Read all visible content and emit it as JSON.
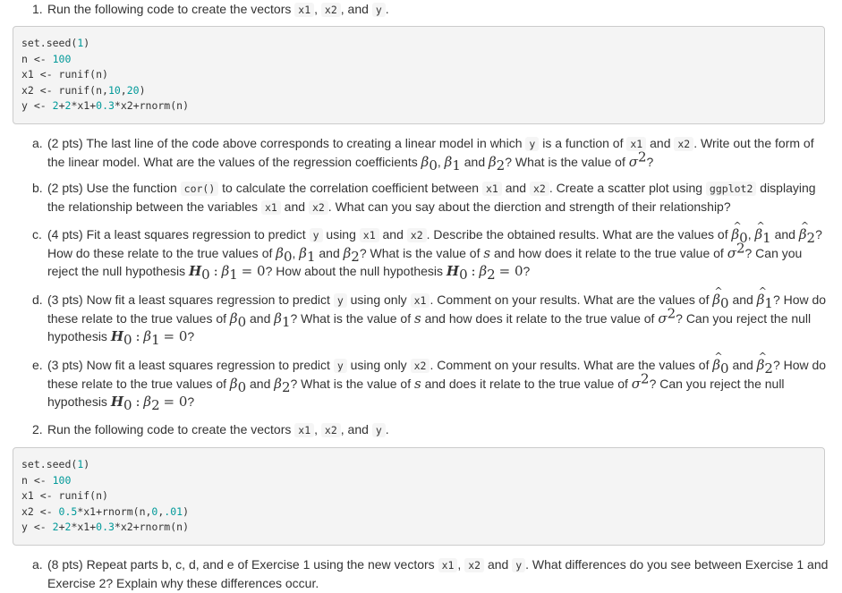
{
  "exercise1": {
    "marker": "1.",
    "intro_text": "Run the following code to create the vectors",
    "vars": [
      "x1",
      "x2",
      "y"
    ],
    "code": [
      {
        "parts": [
          {
            "t": "set.seed("
          },
          {
            "t": "1",
            "n": true
          },
          {
            "t": ")"
          }
        ]
      },
      {
        "parts": [
          {
            "t": "n <- "
          },
          {
            "t": "100",
            "n": true
          }
        ]
      },
      {
        "parts": [
          {
            "t": "x1 <- runif(n)"
          }
        ]
      },
      {
        "parts": [
          {
            "t": "x2 <- runif(n,"
          },
          {
            "t": "10",
            "n": true
          },
          {
            "t": ","
          },
          {
            "t": "20",
            "n": true
          },
          {
            "t": ")"
          }
        ]
      },
      {
        "parts": [
          {
            "t": "y <- "
          },
          {
            "t": "2",
            "n": true
          },
          {
            "t": "+"
          },
          {
            "t": "2",
            "n": true
          },
          {
            "t": "*x1+"
          },
          {
            "t": "0.3",
            "n": true
          },
          {
            "t": "*x2+rnorm(n)"
          }
        ]
      }
    ],
    "parts": [
      {
        "marker": "a.",
        "text": "(2 pts) The last line of the code above corresponds to creating a linear model in which y is a function of x1 and x2. Write out the form of the linear model. What are the values of the regression coefficients β0, β1 and β2? What is the value of σ²?"
      },
      {
        "marker": "b.",
        "text": "(2 pts) Use the function cor() to calculate the correlation coefficient between x1 and x2. Create a scatter plot using ggplot2 displaying the relationship between the variables x1 and x2. What can you say about the dierction and strength of their relationship?"
      },
      {
        "marker": "c.",
        "text": "(4 pts) Fit a least squares regression to predict y using x1 and x2. Describe the obtained results. What are the values of β̂0, β̂1 and β̂2? How do these relate to the true values of β0, β1 and β2? What is the value of s and how does it relate to the true value of σ²? Can you reject the null hypothesis H0 : β1 = 0? How about the null hypothesis H0 : β2 = 0?"
      },
      {
        "marker": "d.",
        "text": "(3 pts) Now fit a least squares regression to predict y using only x1. Comment on your results. What are the values of β̂0 and β̂1? How do these relate to the true values of β0 and β1? What is the value of s and how does it relate to the true value of σ²? Can you reject the null hypothesis H0 : β1 = 0?"
      },
      {
        "marker": "e.",
        "text": "(3 pts) Now fit a least squares regression to predict y using only x2. Comment on your results. What are the values of β̂0 and β̂2? How do these relate to the true values of β0 and β2? What is the value of s and does it relate to the true value of σ²? Can you reject the null hypothesis H0 : β2 = 0?"
      }
    ]
  },
  "exercise2": {
    "marker": "2.",
    "intro_text": "Run the following code to create the vectors",
    "vars": [
      "x1",
      "x2",
      "y"
    ],
    "code": [
      {
        "parts": [
          {
            "t": "set.seed("
          },
          {
            "t": "1",
            "n": true
          },
          {
            "t": ")"
          }
        ]
      },
      {
        "parts": [
          {
            "t": "n <- "
          },
          {
            "t": "100",
            "n": true
          }
        ]
      },
      {
        "parts": [
          {
            "t": "x1 <- runif(n)"
          }
        ]
      },
      {
        "parts": [
          {
            "t": "x2 <- "
          },
          {
            "t": "0.5",
            "n": true
          },
          {
            "t": "*x1+rnorm(n,"
          },
          {
            "t": "0",
            "n": true
          },
          {
            "t": ","
          },
          {
            "t": ".01",
            "n": true
          },
          {
            "t": ")"
          }
        ]
      },
      {
        "parts": [
          {
            "t": "y <- "
          },
          {
            "t": "2",
            "n": true
          },
          {
            "t": "+"
          },
          {
            "t": "2",
            "n": true
          },
          {
            "t": "*x1+"
          },
          {
            "t": "0.3",
            "n": true
          },
          {
            "t": "*x2+rnorm(n)"
          }
        ]
      }
    ],
    "parts": [
      {
        "marker": "a.",
        "text": "(8 pts) Repeat parts b, c, d, and e of Exercise 1 using the new vectors x1, x2 and y. What differences do you see between Exercise 1 and Exercise 2? Explain why these differences occur."
      }
    ]
  },
  "colors": {
    "text": "#333333",
    "code_bg": "#f4f4f4",
    "code_border": "#cccccc",
    "number": "#009999",
    "inline_code_bg": "#f5f5f5"
  }
}
